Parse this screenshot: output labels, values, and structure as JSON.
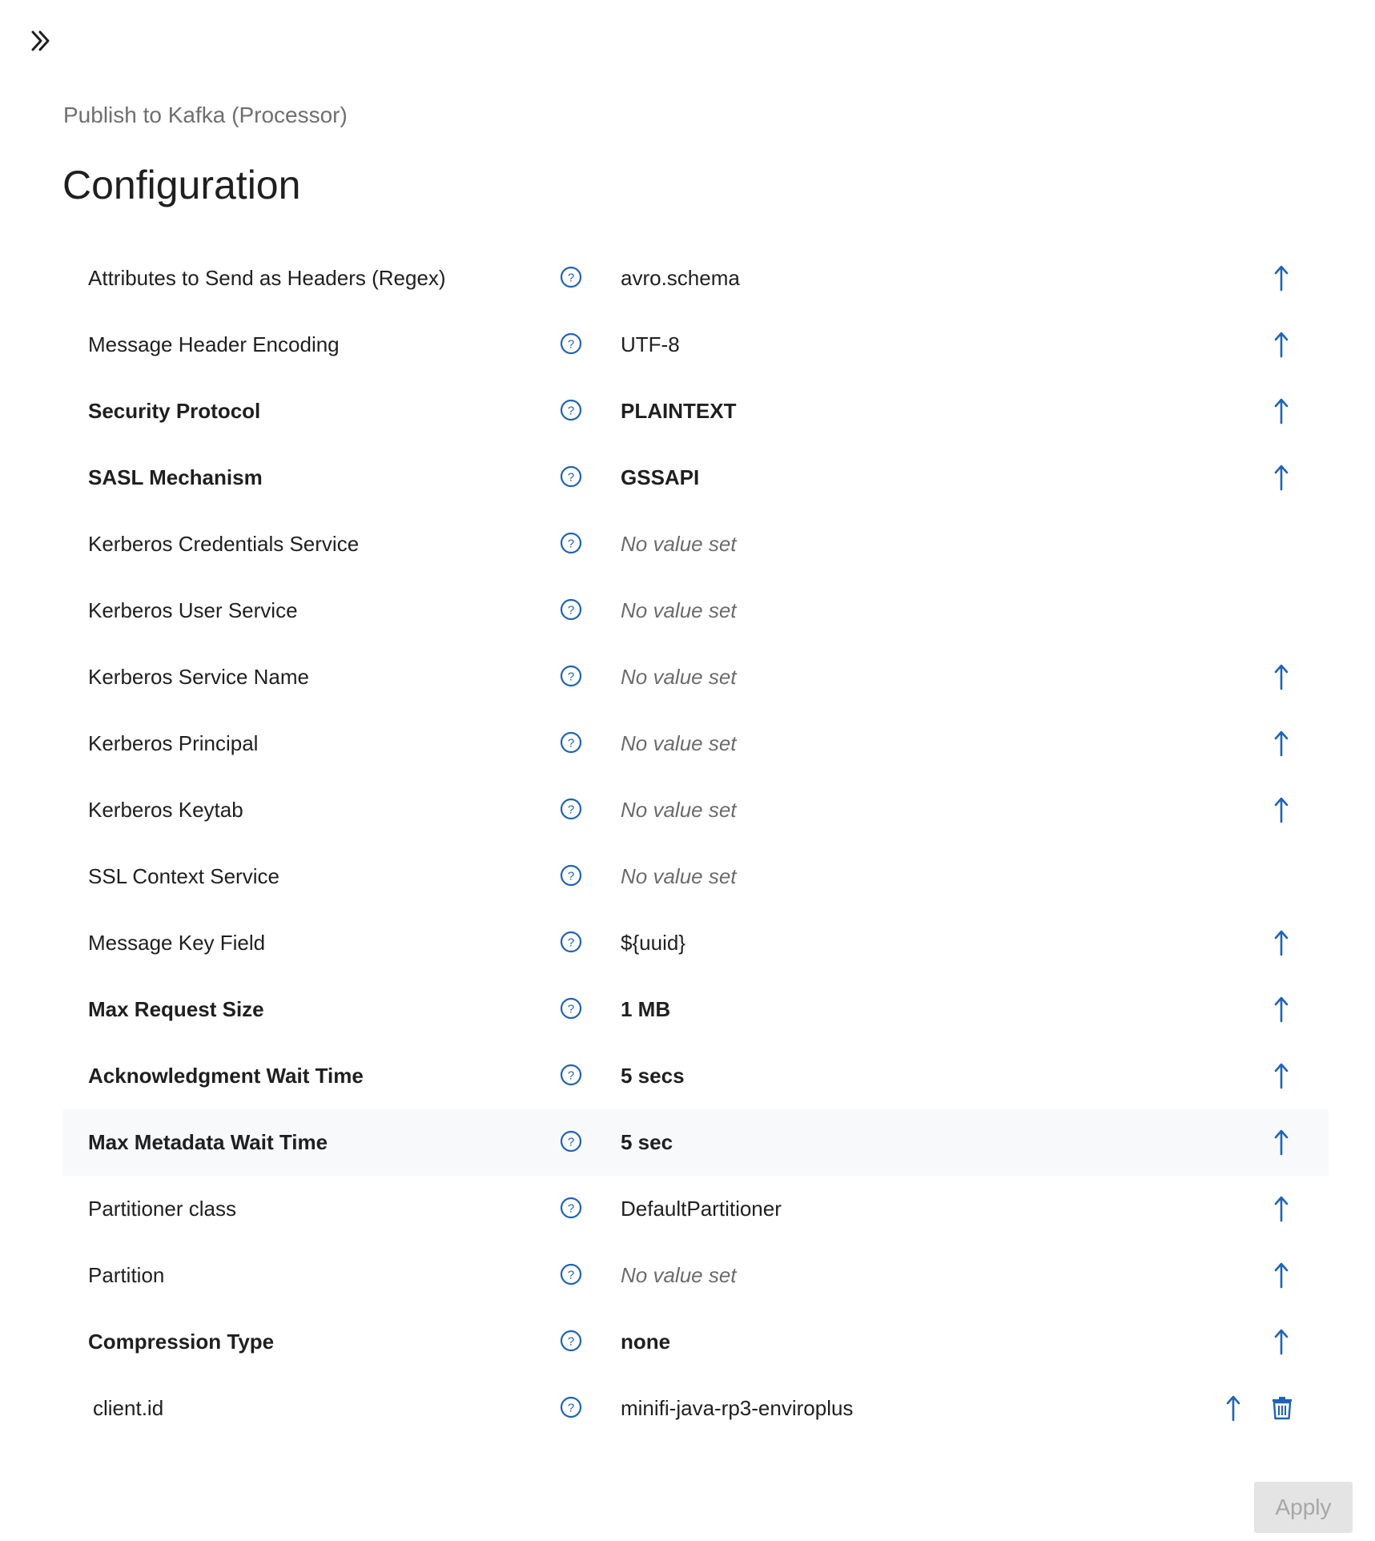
{
  "header": {
    "subtitle": "Publish to Kafka (Processor)",
    "title": "Configuration"
  },
  "properties": [
    {
      "name": "Attributes to Send as Headers (Regex)",
      "value": "avro.schema",
      "required": false,
      "empty": false
    },
    {
      "name": "Message Header Encoding",
      "value": "UTF-8",
      "required": false,
      "empty": false
    },
    {
      "name": "Security Protocol",
      "value": "PLAINTEXT",
      "required": true,
      "empty": false
    },
    {
      "name": "SASL Mechanism",
      "value": "GSSAPI",
      "required": true,
      "empty": false
    },
    {
      "name": "Kerberos Credentials Service",
      "value": "No value set",
      "required": false,
      "empty": true
    },
    {
      "name": "Kerberos User Service",
      "value": "No value set",
      "required": false,
      "empty": true
    },
    {
      "name": "Kerberos Service Name",
      "value": "No value set",
      "required": false,
      "empty": true
    },
    {
      "name": "Kerberos Principal",
      "value": "No value set",
      "required": false,
      "empty": true
    },
    {
      "name": "Kerberos Keytab",
      "value": "No value set",
      "required": false,
      "empty": true
    },
    {
      "name": "SSL Context Service",
      "value": "No value set",
      "required": false,
      "empty": true
    },
    {
      "name": "Message Key Field",
      "value": "${uuid}",
      "required": false,
      "empty": false
    },
    {
      "name": "Max Request Size",
      "value": "1 MB",
      "required": true,
      "empty": false
    },
    {
      "name": "Acknowledgment Wait Time",
      "value": "5 secs",
      "required": true,
      "empty": false
    },
    {
      "name": "Max Metadata Wait Time",
      "value": "5 sec",
      "required": true,
      "empty": false
    },
    {
      "name": "Partitioner class",
      "value": "DefaultPartitioner",
      "required": false,
      "empty": false
    },
    {
      "name": "Partition",
      "value": "No value set",
      "required": false,
      "empty": true
    },
    {
      "name": "Compression Type",
      "value": "none",
      "required": true,
      "empty": false
    },
    {
      "name": "client.id",
      "value": "minifi-java-rp3-enviroplus",
      "required": false,
      "empty": false
    }
  ],
  "actions": {
    "apply_label": "Apply"
  },
  "icons": {
    "collapse": "double-chevron-right-icon",
    "help": "help-circle-icon",
    "parameter": "arrow-up-icon",
    "delete": "trash-icon"
  },
  "colors": {
    "accent": "#1f63b5",
    "text": "#1f1f1f",
    "muted": "#6b6b6b",
    "highlight_row": "#f7f9fb",
    "button_disabled_bg": "#e4e4e4",
    "button_disabled_text": "#a7a7a7"
  }
}
